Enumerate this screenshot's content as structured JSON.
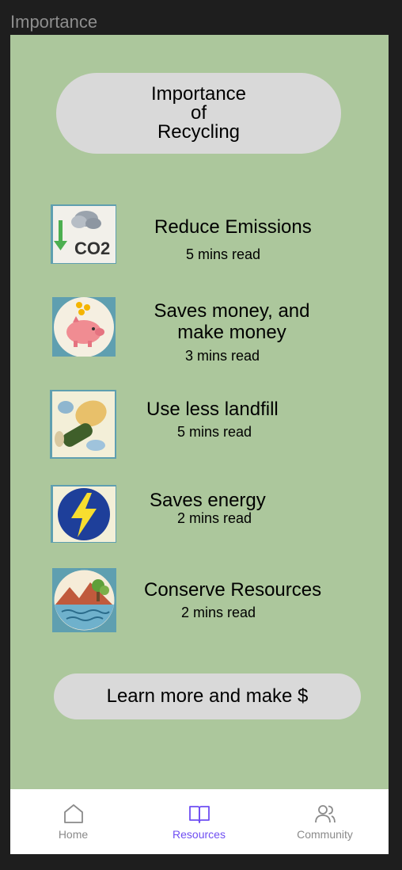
{
  "frame_label": "Importance",
  "header": {
    "title_lines": [
      "Importance",
      "of",
      "Recycling"
    ]
  },
  "items": [
    {
      "title": "Reduce Emissions",
      "read_time": "5 mins read",
      "icon": "co2-icon",
      "icon_text": "CO2"
    },
    {
      "title_lines": [
        "Saves money, and",
        "make money"
      ],
      "read_time": "3 mins read",
      "icon": "piggy-bank-icon"
    },
    {
      "title": "Use less landfill",
      "read_time": "5 mins read",
      "icon": "landfill-trash-icon"
    },
    {
      "title": "Saves energy",
      "read_time": "2 mins read",
      "icon": "lightning-bolt-icon"
    },
    {
      "title": "Conserve Resources",
      "read_time": "2 mins read",
      "icon": "nature-landscape-icon"
    }
  ],
  "learn_more_label": "Learn more and make $",
  "tabbar": {
    "tabs": [
      {
        "label": "Home",
        "icon": "home-icon",
        "active": false
      },
      {
        "label": "Resources",
        "icon": "book-icon",
        "active": true
      },
      {
        "label": "Community",
        "icon": "users-icon",
        "active": false
      }
    ]
  },
  "colors": {
    "background": "#acc79c",
    "pill": "#d9d9d9",
    "active_tab": "#6f4ef2",
    "inactive_tab": "#8a8a8a"
  }
}
